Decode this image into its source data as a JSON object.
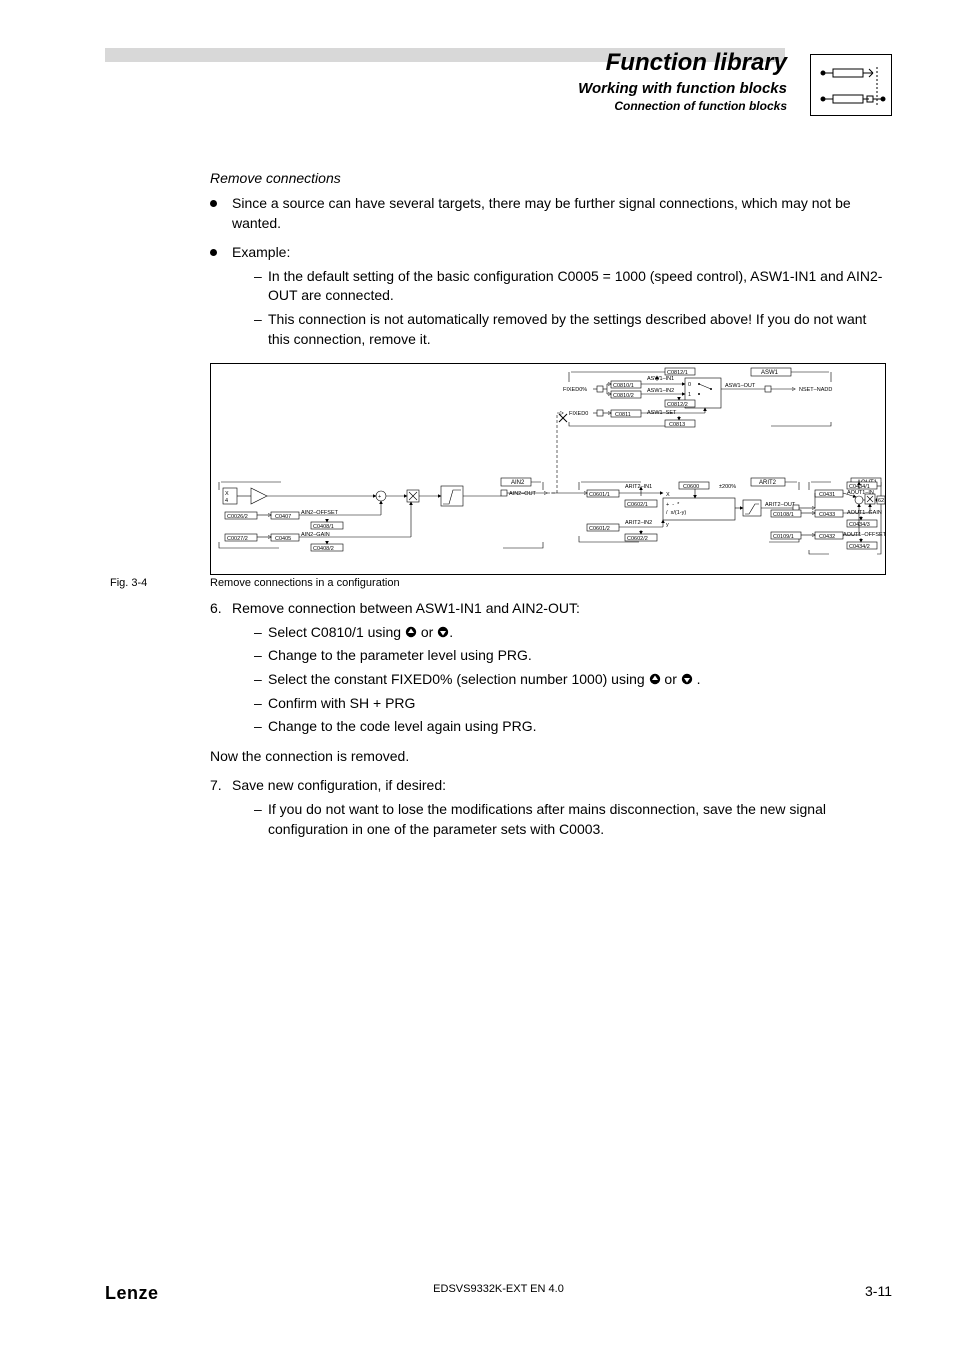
{
  "header": {
    "title": "Function library",
    "subtitle": "Working with function blocks",
    "subsubtitle": "Connection of function blocks"
  },
  "section_heading": "Remove connections",
  "bullet1": "Since a source can have several targets, there may be further signal connections, which may not be wanted.",
  "bullet2": "Example:",
  "bullet2_sub1": "In the default setting of the basic configuration C0005 = 1000 (speed control), ASW1-IN1 and AIN2-OUT are connected.",
  "bullet2_sub2": "This connection is not automatically removed by the settings described above! If you do not want this connection, remove it.",
  "figure": {
    "label": "Fig. 3-4",
    "caption": "Remove connections in a configuration",
    "labels": {
      "asw1": "ASW1",
      "asw1_in1": "ASW1–IN1",
      "asw1_in2": "ASW1–IN2",
      "asw1_set": "ASW1–SET",
      "asw1_out": "ASW1–OUT",
      "nset_nadd": "NSET–NADD",
      "fixed0pct": "FIXED0%",
      "fixed0": "FIXED0",
      "c0812_1": "C0812/1",
      "c0810_1": "C0810/1",
      "c0810_2": "C0810/2",
      "c0812_2": "C0812/2",
      "c0811": "C0811",
      "c0813": "C0813",
      "ain2": "AIN2",
      "ain2_out": "AIN2–OUT",
      "ain2_offset": "AIN2–OFFSET",
      "ain2_gain": "AIN2–GAIN",
      "c0026_2": "C0026/2",
      "c0027_2": "C0027/2",
      "c0407": "C0407",
      "c0405": "C0405",
      "c0408_1": "C0408/1",
      "c0408_2": "C0408/2",
      "arit2": "ARIT2",
      "arit2_in1": "ARIT2–IN1",
      "arit2_in2": "ARIT2–IN2",
      "arit2_out": "ARIT2–OUT",
      "pm200": "±200%",
      "c0600": "C0600",
      "c0601_1": "C0601/1",
      "c0601_2": "C0601/2",
      "c0602_1": "C0602/1",
      "c0602_2": "C0602/2",
      "ops": "x |  + |  - |  * |  / |  x/(1-y)",
      "aout1": "AOUT1",
      "aout1_in": "AOUT1–IN",
      "aout1_gain": "AOUT1–GAIN",
      "aout1_offset": "AOUT1–OFFSET",
      "c0431": "C0431",
      "c0433": "C0433",
      "c0432": "C0432",
      "c0434_1": "C0434/1",
      "c0434_2": "C0434/2",
      "c0434_3": "C0434/3",
      "c0108_1": "C0108/1",
      "c0109_1": "C0109/1",
      "pin62": "62",
      "x1": "X",
      "y1": "y",
      "x6_4": "X6",
      "num4": "4"
    }
  },
  "step6": {
    "num": "6.",
    "text": "Remove connection between ASW1-IN1 and AIN2-OUT:",
    "sub1_a": "Select C0810/1 using ",
    "sub1_b": " or ",
    "sub1_c": ".",
    "sub2": "Change to the parameter level using PRG.",
    "sub3_a": "Select the constant FIXED0% (selection number 1000) using ",
    "sub3_b": " or ",
    "sub3_c": " .",
    "sub4": "Confirm with SH + PRG",
    "sub5": "Change to the code level again using PRG."
  },
  "post_step6": "Now the connection is removed.",
  "step7": {
    "num": "7.",
    "text": "Save new configuration, if desired:",
    "sub1": "If you do not want to lose the modifications after mains disconnection, save the new signal configuration in one of the parameter sets with C0003."
  },
  "footer": {
    "brand": "Lenze",
    "doc": "EDSVS9332K-EXT EN 4.0",
    "page": "3-11"
  }
}
